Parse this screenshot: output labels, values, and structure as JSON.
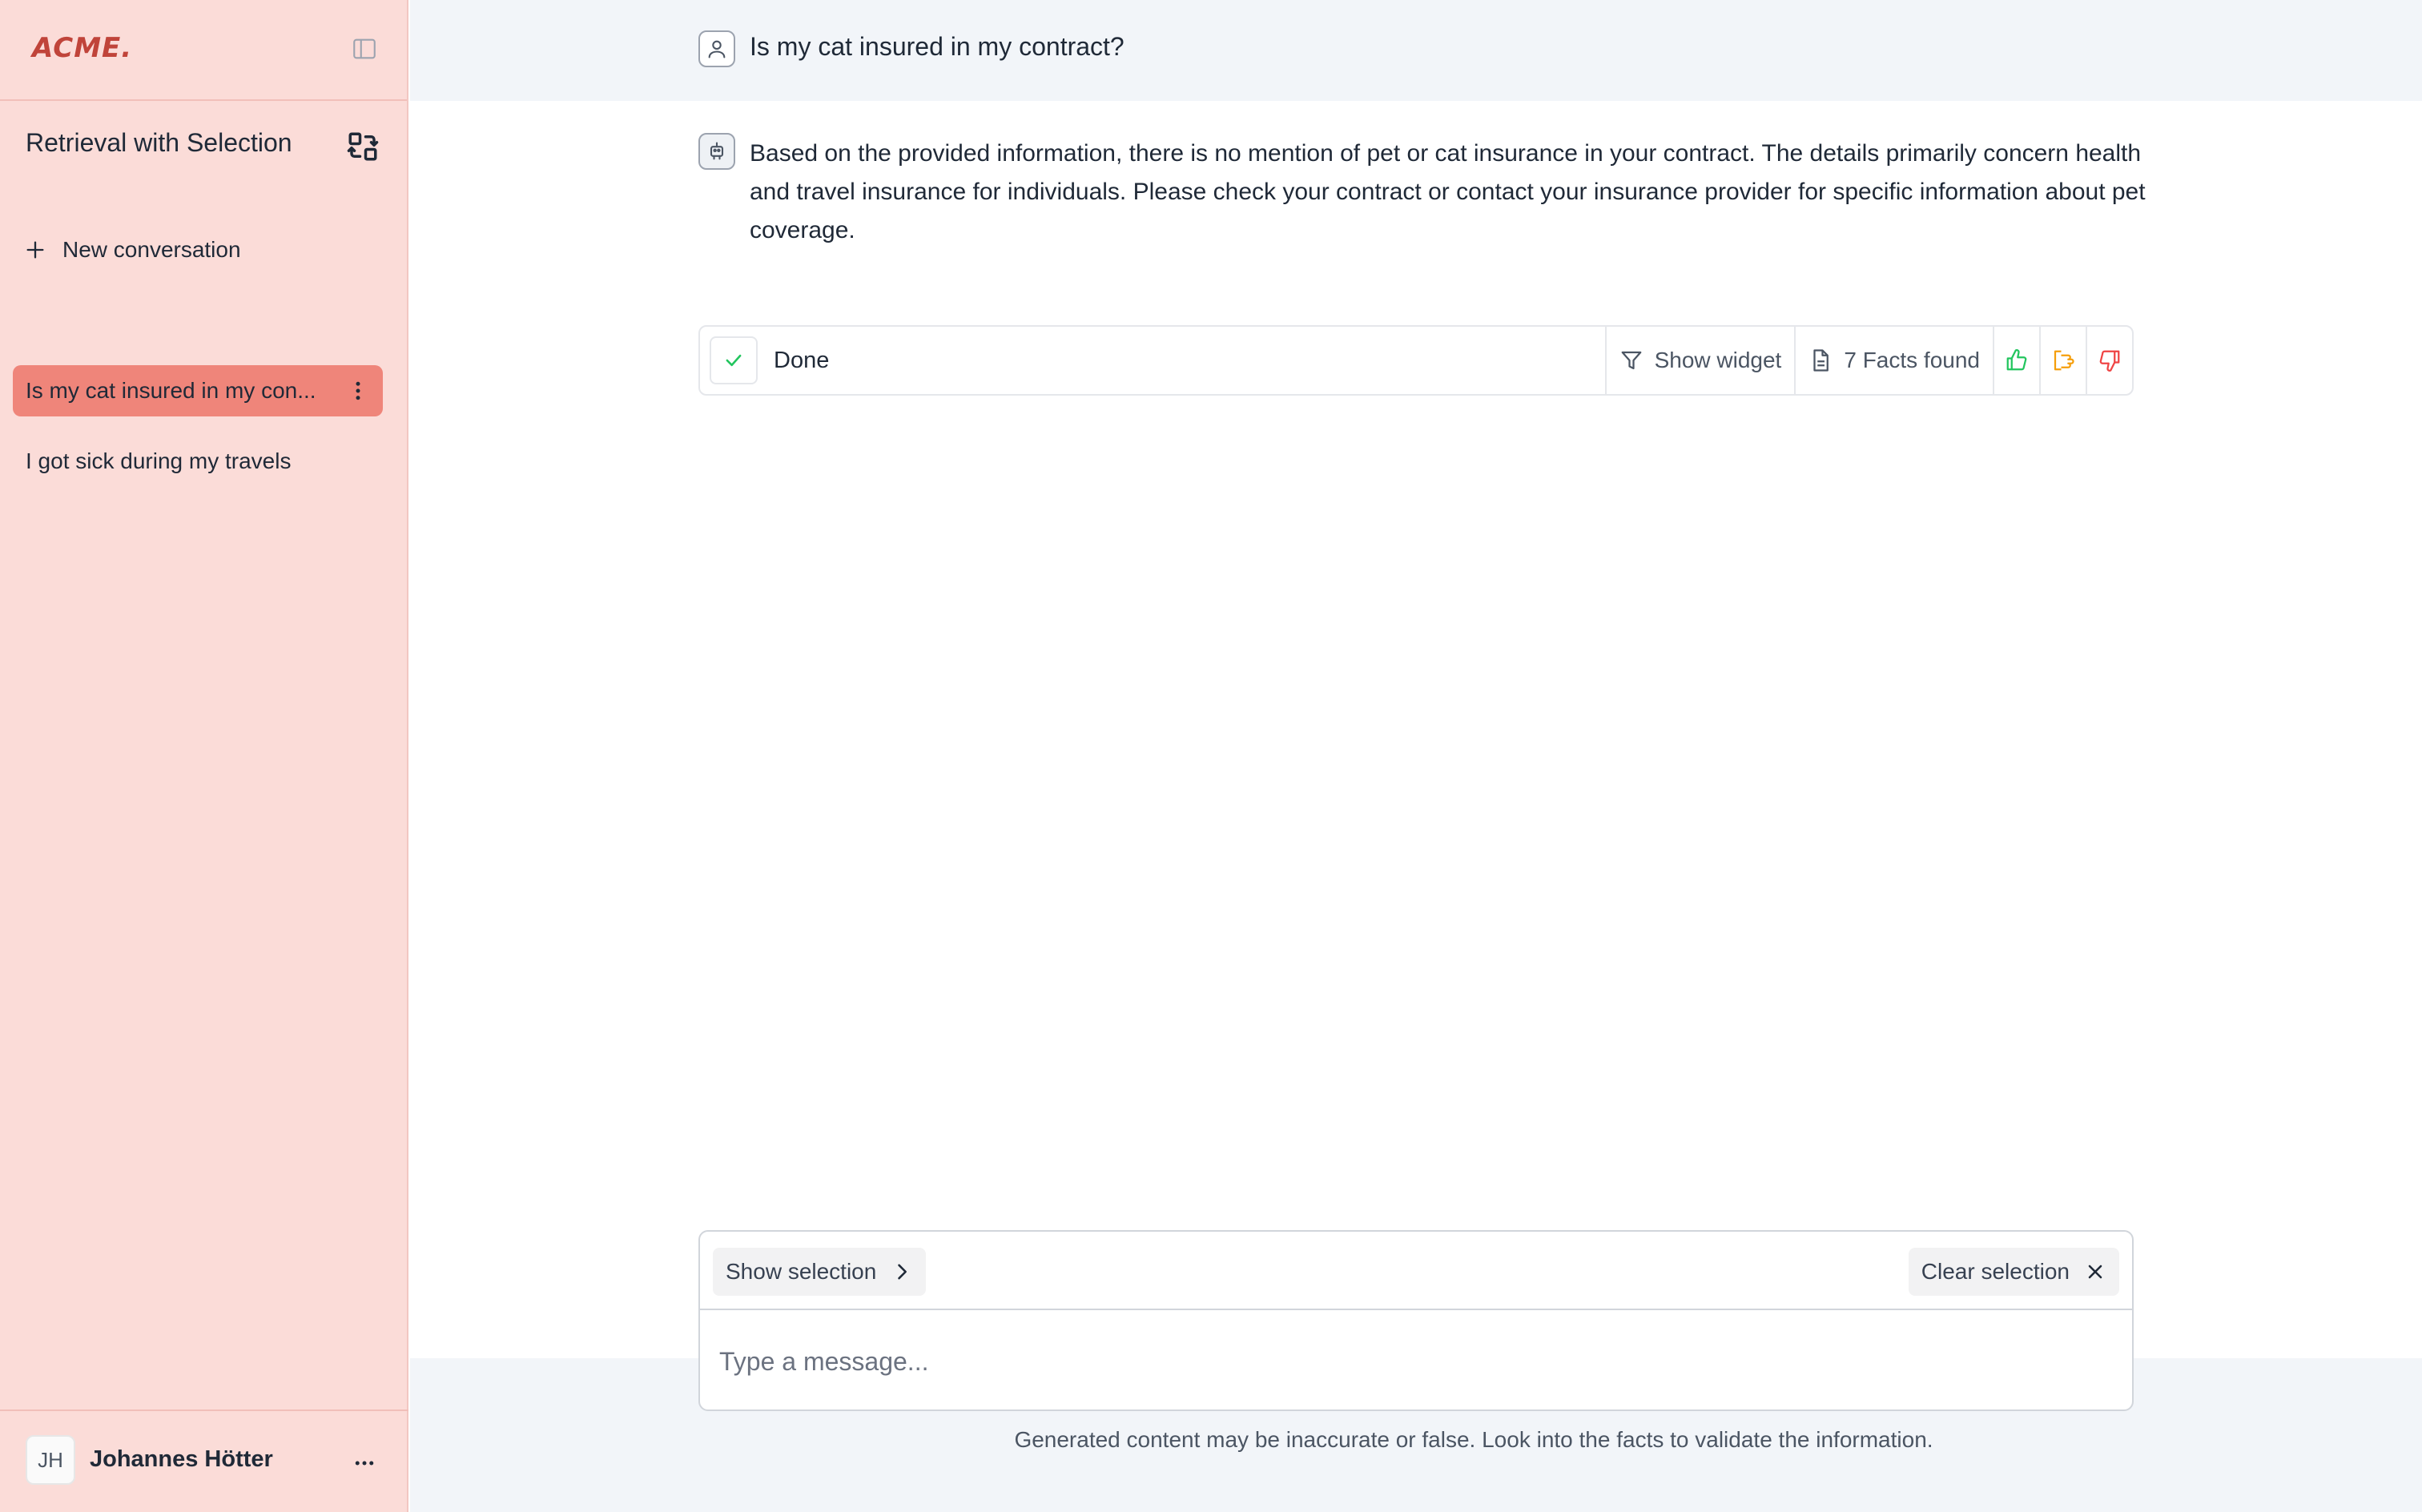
{
  "sidebar": {
    "logo": "ACME.",
    "workspace_title": "Retrieval with Selection",
    "new_conversation_label": "New conversation",
    "conversations": [
      {
        "label": "Is my cat insured in my con...",
        "active": true
      },
      {
        "label": "I got sick during my travels",
        "active": false
      }
    ],
    "user": {
      "initials": "JH",
      "name": "Johannes Hötter"
    }
  },
  "chat": {
    "question": "Is my cat insured in my contract?",
    "answer": "Based on the provided information, there is no mention of pet or cat insurance in your contract. The details primarily concern health and travel insurance for individuals. Please check your contract or contact your insurance provider for specific information about pet coverage.",
    "status": {
      "label": "Done",
      "show_widget_label": "Show widget",
      "facts_label": "7 Facts found"
    }
  },
  "composer": {
    "show_selection_label": "Show selection",
    "clear_selection_label": "Clear selection",
    "placeholder": "Type a message...",
    "disclaimer": "Generated content may be inaccurate or false. Look into the facts to validate the information."
  },
  "colors": {
    "sidebar_bg": "#fbdcd8",
    "active_item": "#ef857a",
    "logo": "#c0443a",
    "thumb_up": "#22c55e",
    "thumb_mid": "#f59e0b",
    "thumb_down": "#ef4444"
  }
}
